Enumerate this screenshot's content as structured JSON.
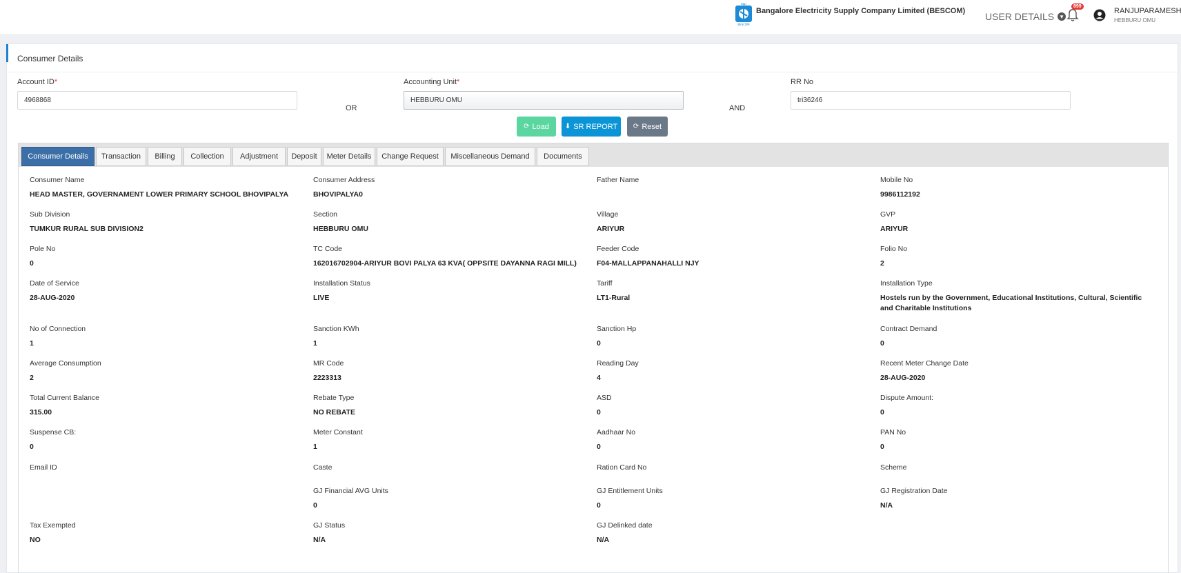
{
  "header": {
    "company": "Bangalore Electricity Supply Company Limited (BESCOM)",
    "logo_top": "ಬೆಸ್ಕಾಂ",
    "logo_bottom": "BESCOM",
    "user_details_label": "USER DETAILS",
    "notification_count": "899",
    "user_name": "RANJUPARAMESH",
    "user_office": "HEBBURU OMU"
  },
  "panel": {
    "title": "Consumer Details"
  },
  "form": {
    "account_id_label": "Account ID",
    "account_id_value": "4968868",
    "or_label": "OR",
    "accounting_unit_label": "Accounting Unit",
    "accounting_unit_value": "HEBBURU OMU",
    "and_label": "AND",
    "rr_no_label": "RR No",
    "rr_no_value": "tri36246",
    "required_mark": "*"
  },
  "buttons": {
    "load": "Load",
    "sr_report": "SR REPORT",
    "reset": "Reset"
  },
  "tabs": [
    "Consumer Details",
    "Transaction",
    "Billing",
    "Collection",
    "Adjustment",
    "Deposit",
    "Meter Details",
    "Change Request",
    "Miscellaneous Demand",
    "Documents"
  ],
  "details": [
    [
      {
        "label": "Consumer Name",
        "value": "HEAD MASTER, GOVERNAMENT LOWER PRIMARY SCHOOL BHOVIPALYA"
      },
      {
        "label": "Consumer Address",
        "value": "BHOVIPALYA0"
      },
      {
        "label": "Father Name",
        "value": ""
      },
      {
        "label": "Mobile No",
        "value": "9986112192"
      }
    ],
    [
      {
        "label": "Sub Division",
        "value": "TUMKUR RURAL SUB DIVISION2"
      },
      {
        "label": "Section",
        "value": "HEBBURU OMU"
      },
      {
        "label": "Village",
        "value": "ARIYUR"
      },
      {
        "label": "GVP",
        "value": "ARIYUR"
      }
    ],
    [
      {
        "label": "Pole No",
        "value": "0"
      },
      {
        "label": "TC Code",
        "value": "162016702904-ARIYUR BOVI PALYA 63 KVA( OPPSITE DAYANNA RAGI MILL)"
      },
      {
        "label": "Feeder Code",
        "value": "F04-MALLAPPANAHALLI NJY"
      },
      {
        "label": "Folio No",
        "value": "2"
      }
    ],
    [
      {
        "label": "Date of Service",
        "value": "28-AUG-2020"
      },
      {
        "label": "Installation Status",
        "value": "LIVE"
      },
      {
        "label": "Tariff",
        "value": "LT1-Rural"
      },
      {
        "label": "Installation Type",
        "value": "Hostels run by the Government, Educational Institutions, Cultural, Scientific and Charitable Institutions"
      }
    ],
    [
      {
        "label": "No of Connection",
        "value": "1"
      },
      {
        "label": "Sanction KWh",
        "value": "1"
      },
      {
        "label": "Sanction Hp",
        "value": "0"
      },
      {
        "label": "Contract Demand",
        "value": "0"
      }
    ],
    [
      {
        "label": "Average Consumption",
        "value": "2"
      },
      {
        "label": "MR Code",
        "value": "2223313"
      },
      {
        "label": "Reading Day",
        "value": "4"
      },
      {
        "label": "Recent Meter Change Date",
        "value": "28-AUG-2020"
      }
    ],
    [
      {
        "label": "Total Current Balance",
        "value": "315.00"
      },
      {
        "label": "Rebate Type",
        "value": "NO REBATE"
      },
      {
        "label": "ASD",
        "value": "0"
      },
      {
        "label": "Dispute Amount:",
        "value": "0"
      }
    ],
    [
      {
        "label": "Suspense CB:",
        "value": "0"
      },
      {
        "label": "Meter Constant",
        "value": "1"
      },
      {
        "label": "Aadhaar No",
        "value": "0"
      },
      {
        "label": "PAN No",
        "value": "0"
      }
    ],
    [
      {
        "label": "Email ID",
        "value": ""
      },
      {
        "label": "Caste",
        "value": ""
      },
      {
        "label": "Ration Card No",
        "value": ""
      },
      {
        "label": "Scheme",
        "value": ""
      }
    ],
    [
      {
        "label": "",
        "value": ""
      },
      {
        "label": "GJ Financial AVG Units",
        "value": "0"
      },
      {
        "label": "GJ Entitlement Units",
        "value": "0"
      },
      {
        "label": "GJ Registration Date",
        "value": "N/A"
      }
    ],
    [
      {
        "label": "Tax Exempted",
        "value": "NO"
      },
      {
        "label": "GJ Status",
        "value": "N/A"
      },
      {
        "label": "GJ Delinked date",
        "value": "N/A"
      },
      {
        "label": "",
        "value": ""
      }
    ]
  ]
}
